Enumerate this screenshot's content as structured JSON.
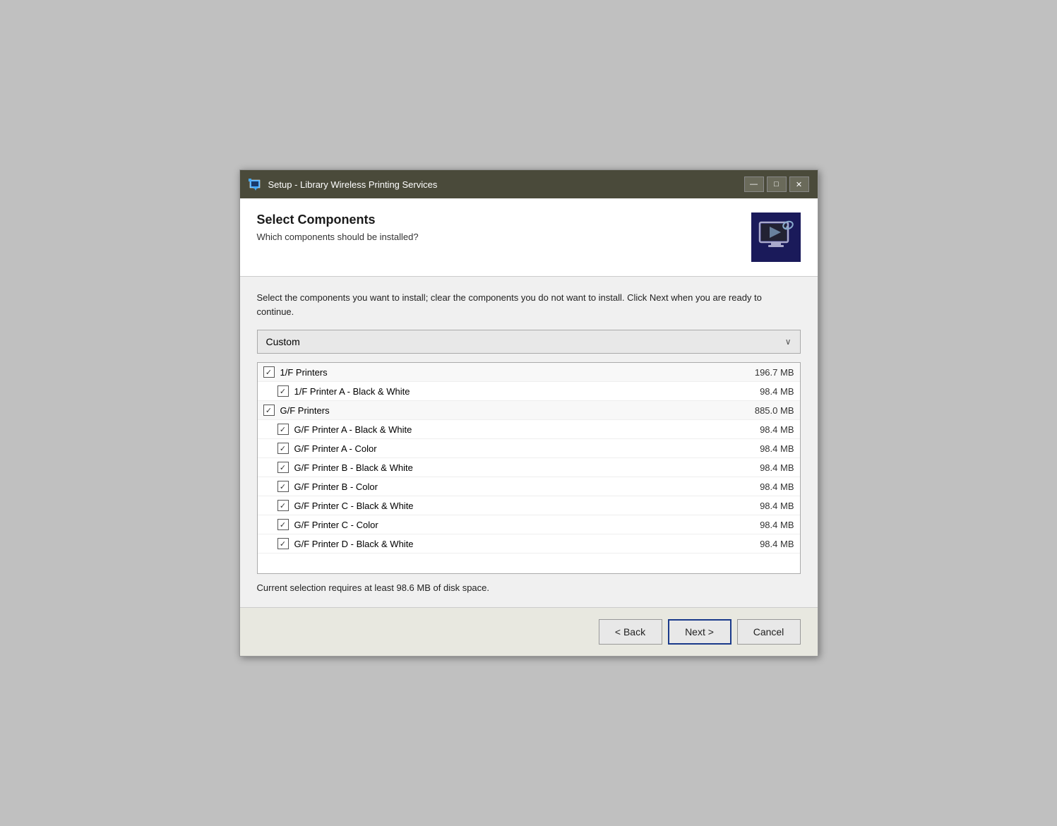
{
  "window": {
    "title": "Setup - Library Wireless Printing Services",
    "controls": {
      "minimize": "—",
      "restore": "□",
      "close": "✕"
    }
  },
  "header": {
    "title": "Select Components",
    "subtitle": "Which components should be installed?"
  },
  "description": "Select the components you want to install; clear the components you do not want to install. Click Next when you are ready to continue.",
  "dropdown": {
    "label": "Custom",
    "arrow": "∨"
  },
  "components": [
    {
      "id": "if-printers",
      "label": "1/F Printers",
      "size": "196.7 MB",
      "checked": true,
      "level": "parent"
    },
    {
      "id": "if-printer-a-bw",
      "label": "1/F Printer A - Black & White",
      "size": "98.4 MB",
      "checked": true,
      "level": "child"
    },
    {
      "id": "gf-printers",
      "label": "G/F Printers",
      "size": "885.0 MB",
      "checked": true,
      "level": "parent"
    },
    {
      "id": "gf-printer-a-bw",
      "label": "G/F Printer A - Black & White",
      "size": "98.4 MB",
      "checked": true,
      "level": "child"
    },
    {
      "id": "gf-printer-a-color",
      "label": "G/F Printer A - Color",
      "size": "98.4 MB",
      "checked": true,
      "level": "child"
    },
    {
      "id": "gf-printer-b-bw",
      "label": "G/F Printer B - Black & White",
      "size": "98.4 MB",
      "checked": true,
      "level": "child"
    },
    {
      "id": "gf-printer-b-color",
      "label": "G/F Printer B - Color",
      "size": "98.4 MB",
      "checked": true,
      "level": "child"
    },
    {
      "id": "gf-printer-c-bw",
      "label": "G/F Printer C - Black & White",
      "size": "98.4 MB",
      "checked": true,
      "level": "child"
    },
    {
      "id": "gf-printer-c-color",
      "label": "G/F Printer C - Color",
      "size": "98.4 MB",
      "checked": true,
      "level": "child"
    },
    {
      "id": "gf-printer-d-bw",
      "label": "G/F Printer D - Black & White",
      "size": "98.4 MB",
      "checked": true,
      "level": "child"
    }
  ],
  "disk_space_text": "Current selection requires at least 98.6 MB of disk space.",
  "buttons": {
    "back": "< Back",
    "next": "Next >",
    "cancel": "Cancel"
  }
}
